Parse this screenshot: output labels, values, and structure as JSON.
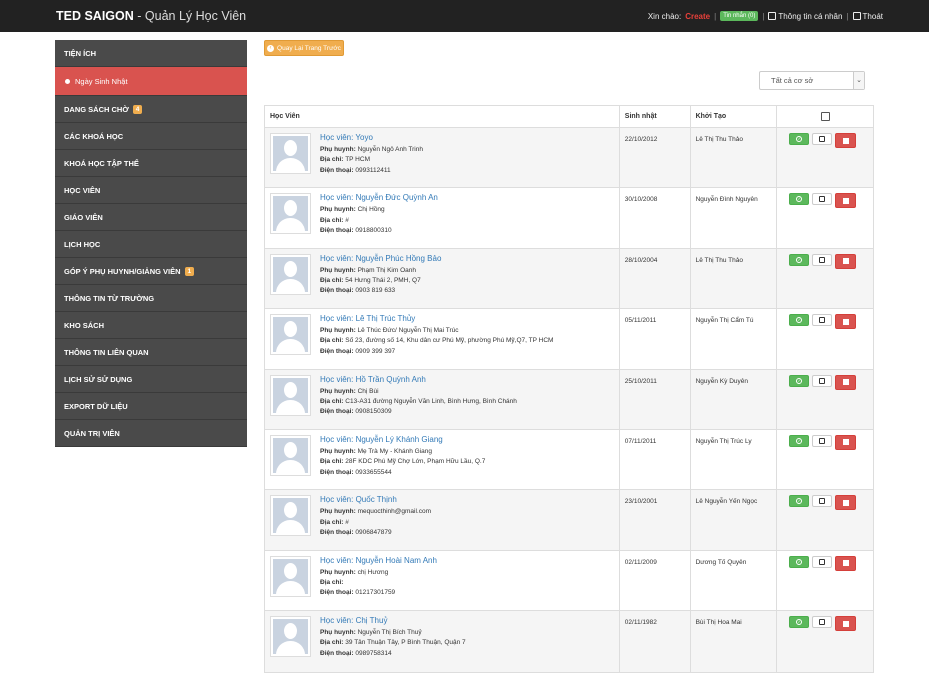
{
  "header": {
    "brand": "TED SAIGON",
    "subtitle": " - Quản Lý Học Viên",
    "greeting": "Xin chào:",
    "username": "Create",
    "messages": "Tin nhắn (0)",
    "profile": "Thông tin cá nhân",
    "logout": "Thoát"
  },
  "sidebar": {
    "items": [
      {
        "label": "Tiện Ích"
      },
      {
        "label": "Ngày Sinh Nhật",
        "active": true
      },
      {
        "label": "Dang sách chờ",
        "badge": "4"
      },
      {
        "label": "Các Khoá Học"
      },
      {
        "label": "Khoá Học Tập Thể"
      },
      {
        "label": "Học Viên"
      },
      {
        "label": "Giáo Viên"
      },
      {
        "label": "Lịch Học"
      },
      {
        "label": "Góp ý Phụ Huynh/Giảng viên",
        "badge": "1"
      },
      {
        "label": "Thông Tin Từ Trường"
      },
      {
        "label": "Kho Sách"
      },
      {
        "label": "Thông Tin Liên Quan"
      },
      {
        "label": "Lịch Sử Sử Dụng"
      },
      {
        "label": "Export Dữ Liệu"
      },
      {
        "label": "Quản Trị Viên"
      }
    ]
  },
  "back_button": "Quay Lại Trang Trước",
  "filter": {
    "selected": "Tất cả cơ sở"
  },
  "table": {
    "headers": [
      "Học Viên",
      "Sinh nhật",
      "Khởi Tạo"
    ],
    "labels": {
      "parent": "Phụ huynh:",
      "address": "Địa chỉ:",
      "phone": "Điện thoại:"
    },
    "rows": [
      {
        "name": "Học viên: Yoyo",
        "parent": "Nguyễn Ngô Anh Trinh",
        "address": "TP HCM",
        "phone": "0993112411",
        "birthday": "22/10/2012",
        "creator": "Lê Thị Thu Thảo"
      },
      {
        "name": "Học viên: Nguyễn Đức Quỳnh An",
        "parent": "Chị Hồng",
        "address": "#",
        "phone": "0918800310",
        "birthday": "30/10/2008",
        "creator": "Nguyễn Đình Nguyên"
      },
      {
        "name": "Học viên: Nguyễn Phúc Hồng Bảo",
        "parent": "Phạm Thị Kim Oanh",
        "address": "54 Hưng Thái 2, PMH, Q7",
        "phone": "0903 819 633",
        "birthday": "28/10/2004",
        "creator": "Lê Thị Thu Thảo"
      },
      {
        "name": "Học viên: Lê Thị Trúc Thủy",
        "parent": "Lê Thúc Đức/ Nguyễn Thị Mai Trúc",
        "address": "Số 23, đường số 14, Khu dân cư Phú Mỹ, phường Phú Mỹ,Q7, TP HCM",
        "phone": "0909 399 397",
        "birthday": "05/11/2011",
        "creator": "Nguyễn Thị Cẩm Tú"
      },
      {
        "name": "Học viên: Hồ Trần Quỳnh Anh",
        "parent": "Chị Bùi",
        "address": "C13-A31 đường Nguyễn Văn Linh, Bình Hưng, Bình Chánh",
        "phone": "0908150309",
        "birthday": "25/10/2011",
        "creator": "Nguyễn Kỳ Duyên"
      },
      {
        "name": "Học viên: Nguyễn Lý Khánh Giang",
        "parent": "Mẹ Trà My - Khánh Giang",
        "address": "28F KDC Phú Mỹ Chợ Lớn, Phạm Hữu Lầu, Q.7",
        "phone": "0933655544",
        "birthday": "07/11/2011",
        "creator": "Nguyễn Thị Trúc Ly"
      },
      {
        "name": "Học viên: Quốc Thịnh",
        "parent": "mequocthinh@gmail.com",
        "address": "#",
        "phone": "0906847879",
        "birthday": "23/10/2001",
        "creator": "Lê Nguyễn Yến Ngọc"
      },
      {
        "name": "Học viên: Nguyễn Hoài Nam Anh",
        "parent": "chị Hương",
        "address": "",
        "phone": "01217301759",
        "birthday": "02/11/2009",
        "creator": "Dương Tố Quyên"
      },
      {
        "name": "Học viên: Chị Thuỷ",
        "parent": "Nguyễn Thị Bích Thuỷ",
        "address": "39 Tân Thuận Tây, P Bình Thuận, Quận 7",
        "phone": "0989758314",
        "birthday": "02/11/1982",
        "creator": "Bùi Thị Hoa Mai"
      }
    ]
  }
}
